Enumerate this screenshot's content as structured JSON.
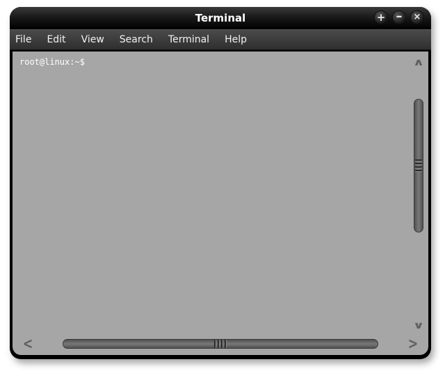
{
  "window": {
    "title": "Terminal"
  },
  "titlebar_buttons": {
    "add": "+",
    "minimize": "–",
    "close": "×"
  },
  "menubar": {
    "items": [
      {
        "label": "File"
      },
      {
        "label": "Edit"
      },
      {
        "label": "View"
      },
      {
        "label": "Search"
      },
      {
        "label": "Terminal"
      },
      {
        "label": "Help"
      }
    ]
  },
  "terminal": {
    "prompt": "root@linux:~$ "
  },
  "scrollbar": {
    "up_glyph": "∧",
    "down_glyph": "∨",
    "left_glyph": "<",
    "right_glyph": ">"
  }
}
